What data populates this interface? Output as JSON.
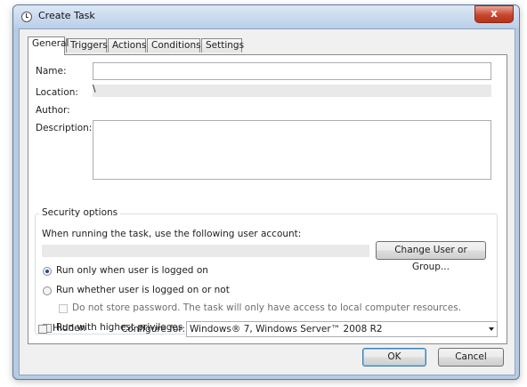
{
  "window": {
    "title": "Create Task",
    "close_glyph": "x",
    "title_icon": "task-scheduler-clock-icon"
  },
  "tabs": [
    {
      "label": "General",
      "active": true
    },
    {
      "label": "Triggers",
      "active": false
    },
    {
      "label": "Actions",
      "active": false
    },
    {
      "label": "Conditions",
      "active": false
    },
    {
      "label": "Settings",
      "active": false
    }
  ],
  "general": {
    "name_label": "Name:",
    "name_value": "",
    "location_label": "Location:",
    "location_value": "\\",
    "author_label": "Author:",
    "author_value": "",
    "description_label": "Description:",
    "description_value": ""
  },
  "security": {
    "legend": "Security options",
    "account_prompt": "When running the task, use the following user account:",
    "account_value": "",
    "change_user_button": "Change User or Group...",
    "run_logged_on": "Run only when user is logged on",
    "run_whether": "Run whether user is logged on or not",
    "no_store_password": "Do not store password.  The task will only have access to local computer resources.",
    "highest_privileges": "Run with highest privileges",
    "selected_option": "run_logged_on"
  },
  "footer": {
    "hidden_label": "Hidden",
    "configure_label": "Configure for:",
    "configure_value": "Windows® 7, Windows Server™ 2008 R2"
  },
  "buttons": {
    "ok": "OK",
    "cancel": "Cancel"
  }
}
